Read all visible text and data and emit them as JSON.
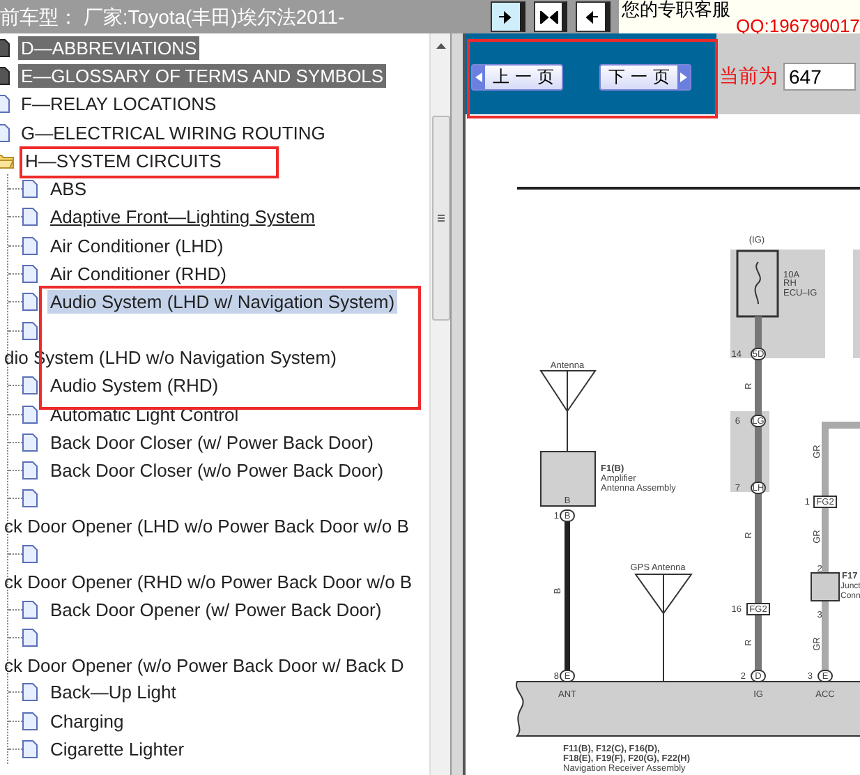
{
  "top_bar": {
    "vehicle_label": "前车型：  厂家:Toyota(丰田)埃尔法2011-",
    "support_label": "您的专职客服",
    "qq_link": "QQ:196790017"
  },
  "tree": [
    {
      "label": "D—ABBREVIATIONS",
      "kind": "page",
      "highlighted": true
    },
    {
      "label": "E—GLOSSARY OF TERMS AND SYMBOLS",
      "kind": "page",
      "highlighted": true
    },
    {
      "label": "F—RELAY LOCATIONS",
      "kind": "page",
      "highlighted": false
    },
    {
      "label": "G—ELECTRICAL WIRING ROUTING",
      "kind": "page",
      "highlighted": false
    },
    {
      "label": "H—SYSTEM CIRCUITS",
      "kind": "folder",
      "highlighted": false,
      "expanded": true,
      "children": [
        {
          "label": "ABS",
          "kind": "inline",
          "selected": false,
          "hovered": false
        },
        {
          "label": "Adaptive Front—Lighting System",
          "kind": "inline",
          "selected": false,
          "hovered": true
        },
        {
          "label": "Air Conditioner (LHD)",
          "kind": "inline",
          "selected": false,
          "hovered": false
        },
        {
          "label": "Air Conditioner (RHD)",
          "kind": "inline",
          "selected": false,
          "hovered": false
        },
        {
          "label": "Audio System (LHD w/ Navigation System)",
          "kind": "inline",
          "selected": true,
          "hovered": false
        },
        {
          "label": "dio System (LHD w/o Navigation System)",
          "kind": "wrapped",
          "selected": false,
          "hovered": false
        },
        {
          "label": "Audio System (RHD)",
          "kind": "inline",
          "selected": false,
          "hovered": false
        },
        {
          "label": "Automatic Light Control",
          "kind": "inline",
          "selected": false,
          "hovered": false
        },
        {
          "label": "Back Door Closer (w/ Power Back Door)",
          "kind": "inline",
          "selected": false,
          "hovered": false
        },
        {
          "label": "Back Door Closer (w/o Power Back Door)",
          "kind": "inline",
          "selected": false,
          "hovered": false
        },
        {
          "label": "ck Door Opener (LHD w/o Power Back Door w/o B",
          "kind": "wrapped",
          "selected": false,
          "hovered": false
        },
        {
          "label": "ck Door Opener (RHD w/o Power Back Door w/o B",
          "kind": "wrapped",
          "selected": false,
          "hovered": false
        },
        {
          "label": "Back Door Opener (w/ Power Back Door)",
          "kind": "inline",
          "selected": false,
          "hovered": false
        },
        {
          "label": "ck Door Opener (w/o Power Back Door w/ Back D",
          "kind": "wrapped",
          "selected": false,
          "hovered": false
        },
        {
          "label": "Back—Up Light",
          "kind": "inline",
          "selected": false,
          "hovered": false
        },
        {
          "label": "Charging",
          "kind": "inline",
          "selected": false,
          "hovered": false
        },
        {
          "label": "Cigarette Lighter",
          "kind": "inline",
          "selected": false,
          "hovered": false
        }
      ]
    }
  ],
  "pager": {
    "prev": "上 一 页",
    "next": "下 一 页",
    "current_label": "当前为",
    "page": "647"
  },
  "diagram": {
    "labels": [
      "(IG)",
      "10A",
      "RH",
      "ECU–IG",
      "14",
      "5D",
      "R",
      "6",
      "LG",
      "7",
      "LH",
      "R",
      "16",
      "FG2",
      "R",
      "2",
      "D",
      "IG",
      "GR",
      "1",
      "FG2",
      "GR",
      "2",
      "F17",
      "Junct",
      "Conn",
      "3",
      "GR",
      "3",
      "E",
      "ACC",
      "Antenna",
      "F1(B)",
      "Amplifier",
      "Antenna Assembly",
      "B",
      "1",
      "B",
      "B",
      "GPS Antenna",
      "8",
      "E",
      "ANT",
      "F11(B), F12(C), F16(D),",
      "F18(E), F19(F), F20(G), F22(H)",
      "Navigation Receiver Assembly"
    ]
  }
}
